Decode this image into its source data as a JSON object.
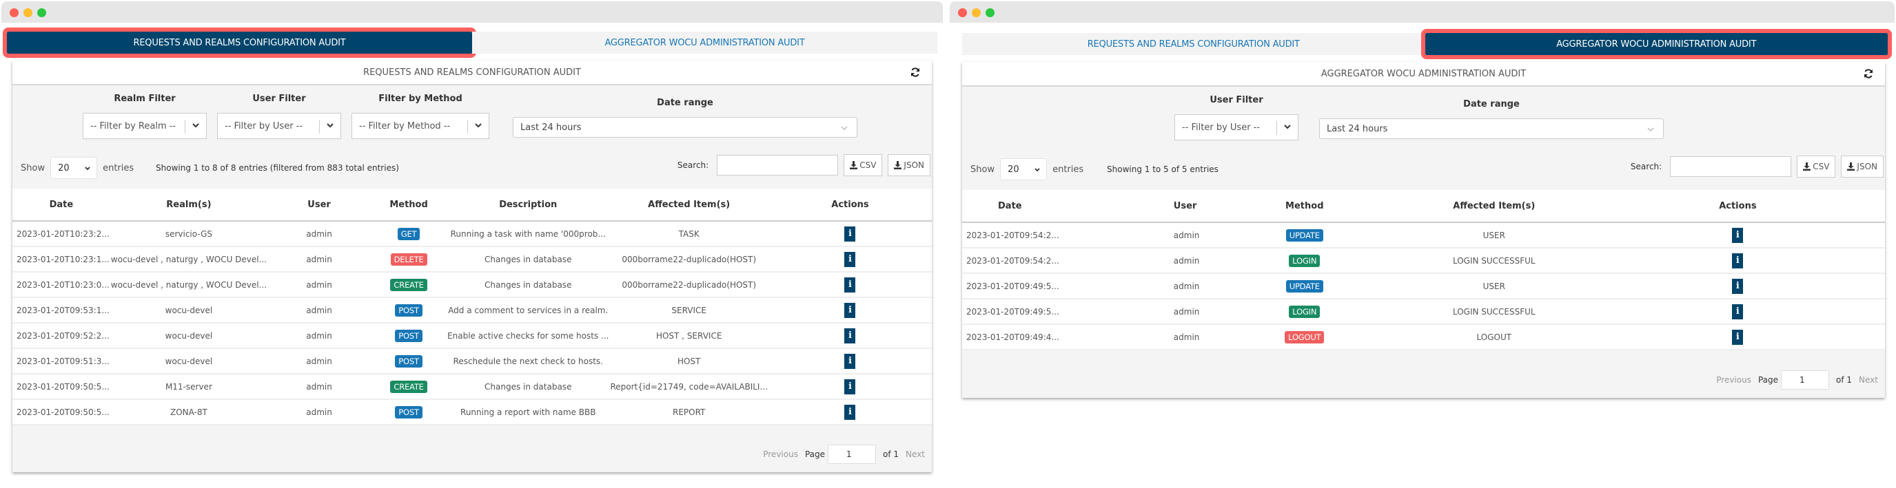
{
  "colors": {
    "tab_active_bg": "#00446b",
    "highlight": "#fe5f5f",
    "link": "#1776b6",
    "badge_blue": "#1776b6",
    "badge_red": "#f05f5f",
    "badge_green": "#1a8c62"
  },
  "left": {
    "tabs": [
      {
        "label": "REQUESTS AND REALMS CONFIGURATION AUDIT",
        "active": true
      },
      {
        "label": "AGGREGATOR WOCU ADMINISTRATION AUDIT",
        "active": false
      }
    ],
    "panel_title": "REQUESTS AND REALMS CONFIGURATION AUDIT",
    "refresh_icon": "refresh-icon",
    "filters": {
      "realm": {
        "label": "Realm Filter",
        "placeholder": "-- Filter by Realm --"
      },
      "user": {
        "label": "User Filter",
        "placeholder": "-- Filter by User --"
      },
      "method": {
        "label": "Filter by Method",
        "placeholder": "-- Filter by Method --"
      },
      "date_range": {
        "label": "Date range",
        "value": "Last 24 hours"
      }
    },
    "show_label": "Show",
    "entries_value": "20",
    "entries_label": "entries",
    "info": "Showing 1 to 8 of 8 entries (filtered from 883 total entries)",
    "search_label": "Search:",
    "search_value": "",
    "csv_label": "CSV",
    "json_label": "JSON",
    "columns": [
      "Date",
      "Realm(s)",
      "User",
      "Method",
      "Description",
      "Affected Item(s)",
      "Actions"
    ],
    "rows": [
      {
        "date": "2023-01-20T10:23:2...",
        "realm": "servicio-GS",
        "user": "admin",
        "method": "GET",
        "method_color": "blue",
        "description": "Running a task with name '000prob...",
        "affected": "TASK"
      },
      {
        "date": "2023-01-20T10:23:1...",
        "realm": "wocu-devel , naturgy , WOCU Devel...",
        "user": "admin",
        "method": "DELETE",
        "method_color": "red",
        "description": "Changes in database",
        "affected": "000borrame22-duplicado(HOST)"
      },
      {
        "date": "2023-01-20T10:23:0...",
        "realm": "wocu-devel , naturgy , WOCU Devel...",
        "user": "admin",
        "method": "CREATE",
        "method_color": "green",
        "description": "Changes in database",
        "affected": "000borrame22-duplicado(HOST)"
      },
      {
        "date": "2023-01-20T09:53:1...",
        "realm": "wocu-devel",
        "user": "admin",
        "method": "POST",
        "method_color": "blue",
        "description": "Add a comment to services in a realm.",
        "affected": "SERVICE"
      },
      {
        "date": "2023-01-20T09:52:2...",
        "realm": "wocu-devel",
        "user": "admin",
        "method": "POST",
        "method_color": "blue",
        "description": "Enable active checks for some hosts ...",
        "affected": "HOST , SERVICE"
      },
      {
        "date": "2023-01-20T09:51:3...",
        "realm": "wocu-devel",
        "user": "admin",
        "method": "POST",
        "method_color": "blue",
        "description": "Reschedule the next check to hosts.",
        "affected": "HOST"
      },
      {
        "date": "2023-01-20T09:50:5...",
        "realm": "M11-server",
        "user": "admin",
        "method": "CREATE",
        "method_color": "green",
        "description": "Changes in database",
        "affected": "Report{id=21749, code=AVAILABILI..."
      },
      {
        "date": "2023-01-20T09:50:5...",
        "realm": "ZONA-8T",
        "user": "admin",
        "method": "POST",
        "method_color": "blue",
        "description": "Running a report with name BBB",
        "affected": "REPORT"
      }
    ],
    "pagination": {
      "previous": "Previous",
      "page_label": "Page",
      "page_value": "1",
      "of_label": "of 1",
      "next": "Next"
    }
  },
  "right": {
    "tabs": [
      {
        "label": "REQUESTS AND REALMS CONFIGURATION AUDIT",
        "active": false
      },
      {
        "label": "AGGREGATOR WOCU ADMINISTRATION AUDIT",
        "active": true
      }
    ],
    "panel_title": "AGGREGATOR WOCU ADMINISTRATION AUDIT",
    "refresh_icon": "refresh-icon",
    "filters": {
      "user": {
        "label": "User Filter",
        "placeholder": "-- Filter by User --"
      },
      "date_range": {
        "label": "Date range",
        "value": "Last 24 hours"
      }
    },
    "show_label": "Show",
    "entries_value": "20",
    "entries_label": "entries",
    "info": "Showing 1 to 5 of 5 entries",
    "search_label": "Search:",
    "search_value": "",
    "csv_label": "CSV",
    "json_label": "JSON",
    "columns": [
      "Date",
      "User",
      "Method",
      "Affected Item(s)",
      "Actions"
    ],
    "rows": [
      {
        "date": "2023-01-20T09:54:2...",
        "user": "admin",
        "method": "UPDATE",
        "method_color": "blue",
        "affected": "USER"
      },
      {
        "date": "2023-01-20T09:54:2...",
        "user": "admin",
        "method": "LOGIN",
        "method_color": "green",
        "affected": "LOGIN SUCCESSFUL"
      },
      {
        "date": "2023-01-20T09:49:5...",
        "user": "admin",
        "method": "UPDATE",
        "method_color": "blue",
        "affected": "USER"
      },
      {
        "date": "2023-01-20T09:49:5...",
        "user": "admin",
        "method": "LOGIN",
        "method_color": "green",
        "affected": "LOGIN SUCCESSFUL"
      },
      {
        "date": "2023-01-20T09:49:4...",
        "user": "admin",
        "method": "LOGOUT",
        "method_color": "red",
        "affected": "LOGOUT"
      }
    ],
    "pagination": {
      "previous": "Previous",
      "page_label": "Page",
      "page_value": "1",
      "of_label": "of 1",
      "next": "Next"
    }
  }
}
